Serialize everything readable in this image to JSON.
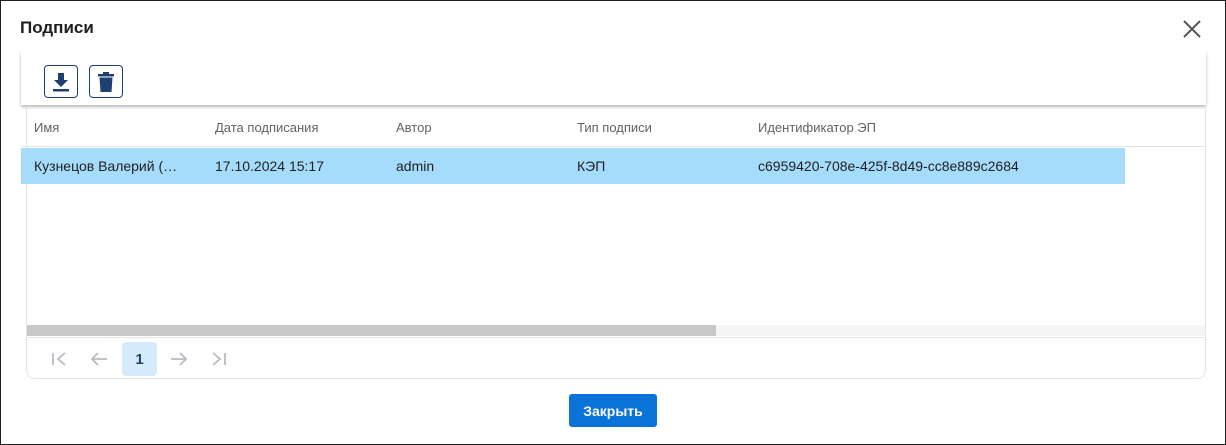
{
  "dialog": {
    "title": "Подписи",
    "close_icon": "close-icon"
  },
  "toolbar": {
    "download_icon": "download-icon",
    "delete_icon": "trash-icon"
  },
  "table": {
    "columns": [
      "Имя",
      "Дата подписания",
      "Автор",
      "Тип подписи",
      "Идентификатор ЭП"
    ],
    "rows": [
      {
        "name": "Кузнецов Валерий (…",
        "date": "17.10.2024 15:17",
        "author": "admin",
        "type": "КЭП",
        "id": "c6959420-708e-425f-8d49-cc8e889c2684",
        "selected": true
      }
    ],
    "selected_color": "#a6dcfb"
  },
  "pager": {
    "current_page": "1",
    "first_icon": "first-page-icon",
    "prev_icon": "arrow-left-icon",
    "next_icon": "arrow-right-icon",
    "last_icon": "last-page-icon"
  },
  "footer": {
    "close_label": "Закрыть",
    "accent": "#0a73d9"
  }
}
